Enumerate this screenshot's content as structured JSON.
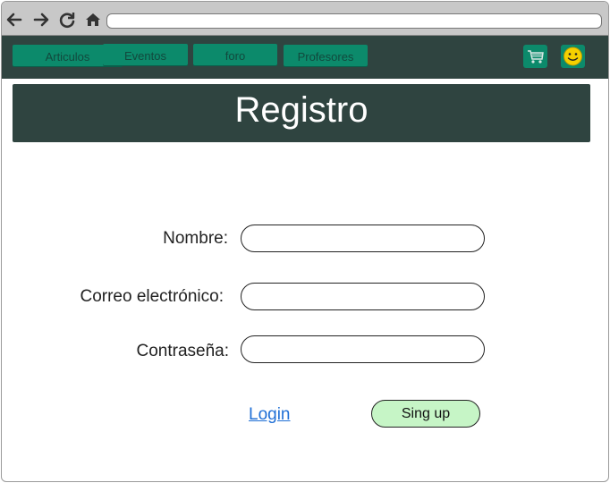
{
  "browser": {
    "back_icon": "arrow-left-icon",
    "forward_icon": "arrow-right-icon",
    "reload_icon": "reload-icon",
    "home_icon": "home-icon",
    "url": ""
  },
  "navbar": {
    "items": [
      {
        "label": "Articulos"
      },
      {
        "label": "Eventos"
      },
      {
        "label": "foro"
      },
      {
        "label": "Profesores"
      }
    ],
    "cart_icon": "shopping-cart-icon",
    "user_icon": "smiley-user-icon"
  },
  "banner": {
    "title": "Registro"
  },
  "form": {
    "name_label": "Nombre:",
    "name_value": "",
    "email_label": "Correo electrónico:",
    "email_value": "",
    "password_label": "Contraseña:",
    "password_value": ""
  },
  "actions": {
    "login_label": "Login",
    "signup_label": "Sing up"
  },
  "colors": {
    "header_bg": "#2f4440",
    "tab_bg": "#0c8a6b",
    "tab_text": "#12493d",
    "signup_bg": "#c6f5c6",
    "link": "#1f6fd6"
  }
}
